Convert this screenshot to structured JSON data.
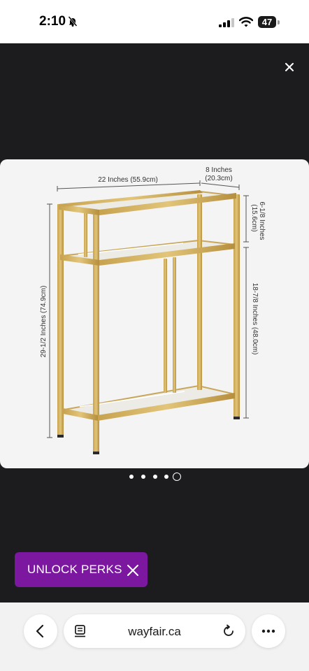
{
  "status_bar": {
    "time": "2:10",
    "battery": "47",
    "icons": [
      "bell-slash-icon",
      "cellular-signal-icon",
      "wifi-icon",
      "battery-icon"
    ]
  },
  "viewer": {
    "close_icon": "close-icon",
    "image": {
      "subject": "gold-frame-console-table",
      "dimensions": {
        "width": "22 Inches (55.9cm)",
        "depth_top": "8 Inches",
        "depth_bottom": "(20.3cm)",
        "top_gap_line1": "6-1/8 Inches",
        "top_gap_line2": "(15.6cm)",
        "lower_gap": "18-7/8 Inches (48.0cm)",
        "height": "29-1/2 Inches (74.9cm)"
      }
    },
    "carousel": {
      "count": 5,
      "active_index": 4
    }
  },
  "promo": {
    "label": "UNLOCK PERKS",
    "color": "#7b189f"
  },
  "browser": {
    "url": "wayfair.ca",
    "icons": [
      "chevron-left-icon",
      "reader-mode-icon",
      "reload-icon",
      "more-icon"
    ]
  }
}
